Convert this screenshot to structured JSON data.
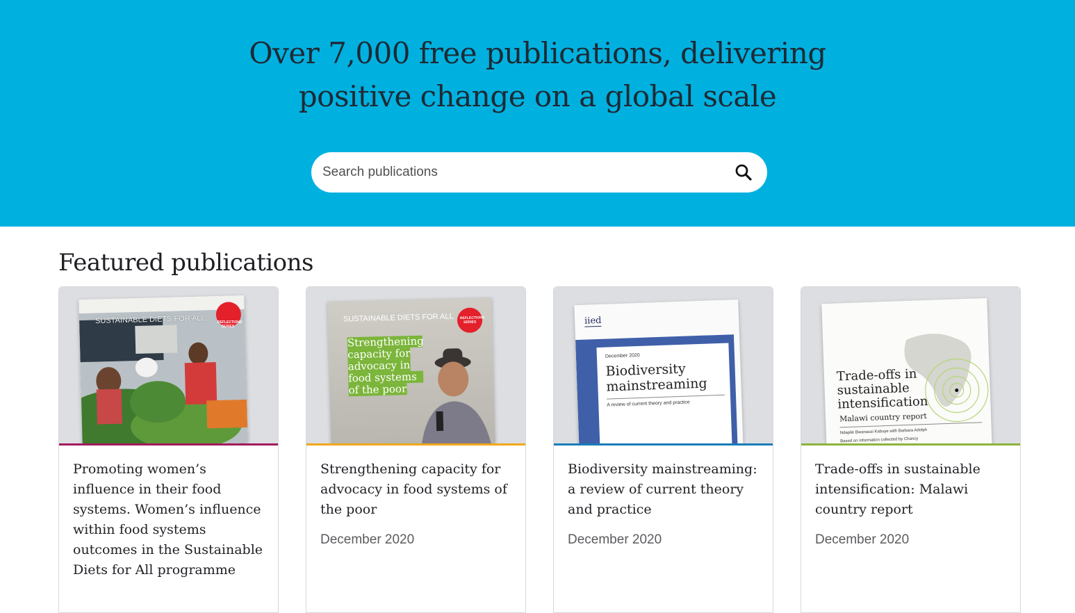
{
  "hero": {
    "title_line1": "Over 7,000 free publications, delivering",
    "title_line2": "positive change on a global scale"
  },
  "search": {
    "placeholder": "Search publications",
    "icon": "search-icon"
  },
  "featured": {
    "heading": "Featured publications",
    "cards": [
      {
        "title": "Promoting women’s influence in their food systems. Women’s influence within food systems outcomes in the Sustainable Diets for All programme",
        "date": "",
        "accent": "#a3195b",
        "cover": {
          "series": "SUSTAINABLE DIETS FOR ALL",
          "badge": "REFLECTIONS SERIES"
        }
      },
      {
        "title": "Strengthening capacity for advocacy in food systems of the poor",
        "date": "December 2020",
        "accent": "#f0a81a",
        "cover": {
          "series": "SUSTAINABLE DIETS FOR ALL",
          "badge": "REFLECTIONS SERIES",
          "headline": [
            "Strengthening",
            "capacity for",
            "advocacy in",
            "food systems",
            "of the poor"
          ]
        }
      },
      {
        "title": "Biodiversity mainstreaming: a review of current theory and practice",
        "date": "December 2020",
        "accent": "#1a7cb8",
        "cover": {
          "logo": "iied",
          "date": "December 2020",
          "headline": [
            "Biodiversity",
            "mainstreaming"
          ],
          "subtitle": "A review of current theory and practice"
        }
      },
      {
        "title": "Trade-offs in sustainable intensification: Malawi country report",
        "date": "December 2020",
        "accent": "#8cb43c",
        "cover": {
          "headline": [
            "Trade-offs in",
            "sustainable",
            "intensification"
          ],
          "subtitle": "Malawi country report",
          "authors": "Ndapile Bwanausi Kabuye with Barbara Adolph",
          "note": "Based on information collected by Chancy"
        }
      }
    ]
  },
  "colors": {
    "hero_bg": "#00b1e0",
    "text_dark": "#1f2024",
    "date_gray": "#5a5b5e"
  }
}
